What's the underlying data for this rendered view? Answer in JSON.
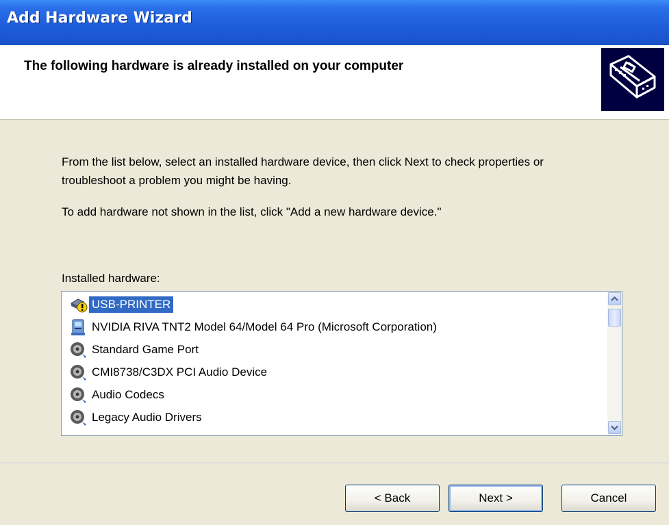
{
  "window": {
    "title": "Add Hardware Wizard"
  },
  "header": {
    "title": "The following hardware is already installed on your computer"
  },
  "instructions": {
    "paragraph1": "From the list below, select an installed hardware device, then click Next to check properties or troubleshoot a problem you might be having.",
    "paragraph2": "To add hardware not shown in the list, click \"Add a new hardware device.\""
  },
  "list": {
    "label": "Installed hardware:",
    "items": [
      {
        "label": "USB-PRINTER",
        "icon": "printer-warning-icon",
        "selected": true
      },
      {
        "label": "NVIDIA RIVA TNT2 Model 64/Model 64 Pro (Microsoft Corporation)",
        "icon": "display-adapter-icon",
        "selected": false
      },
      {
        "label": "Standard Game Port",
        "icon": "sound-device-icon",
        "selected": false
      },
      {
        "label": "CMI8738/C3DX PCI Audio Device",
        "icon": "sound-device-icon",
        "selected": false
      },
      {
        "label": "Audio Codecs",
        "icon": "sound-device-icon",
        "selected": false
      },
      {
        "label": "Legacy Audio Drivers",
        "icon": "sound-device-icon",
        "selected": false
      }
    ]
  },
  "buttons": {
    "back": "< Back",
    "next": "Next >",
    "cancel": "Cancel"
  },
  "colors": {
    "titlebar": "#1f5fdc",
    "selection": "#316ac5",
    "dialog_bg": "#ece9d8"
  }
}
